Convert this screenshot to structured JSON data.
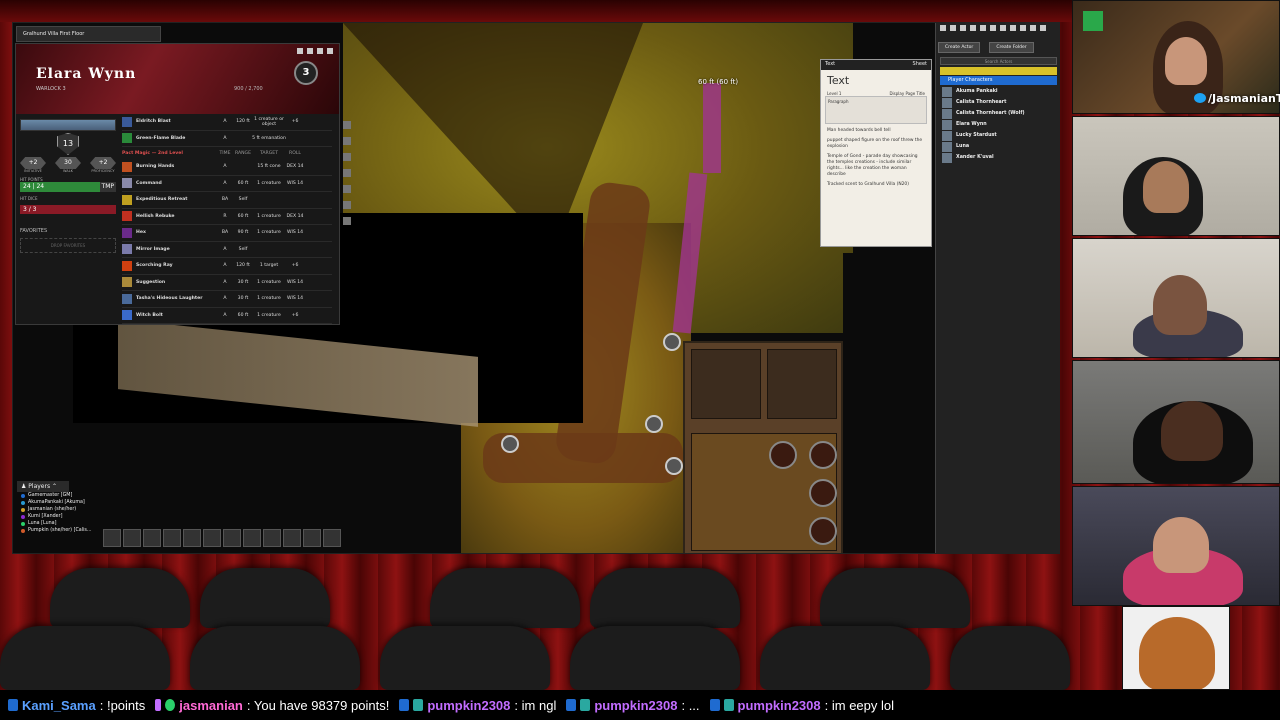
{
  "map": {
    "tab_title": "Gralhund Villa First Floor",
    "measure": "60 ft (60 ft)"
  },
  "sheet": {
    "name": "Elara Wynn",
    "class": "WARLOCK 3",
    "level": "3",
    "xp": "900 / 2,700",
    "ac": "13",
    "stats": [
      {
        "value": "+2",
        "label": "INITIATIVE"
      },
      {
        "value": "30",
        "label": "WALK"
      },
      {
        "value": "+2",
        "label": "PROFICIENCY"
      }
    ],
    "hp_label": "HIT POINTS",
    "hp": "24",
    "hp_max": "24",
    "tmp": "TMP",
    "hd_label": "HIT DICE",
    "hd": "3 / 3",
    "favorites": "FAVORITES",
    "drop_favorites": "DROP FAVORITES",
    "cantrips": [
      {
        "name": "Eldritch Blast",
        "time": "A",
        "range": "120 ft",
        "target": "1 creature or object",
        "roll": "+6",
        "color": "#3a5a9a"
      },
      {
        "name": "Green-Flame Blade",
        "time": "A",
        "range": "",
        "target": "5 ft emanation",
        "roll": "",
        "color": "#2a8a3a"
      }
    ],
    "section": {
      "title": "Pact Magic — 2nd Level",
      "cols": [
        "TIME",
        "RANGE",
        "TARGET",
        "ROLL"
      ]
    },
    "spells": [
      {
        "name": "Burning Hands",
        "time": "A",
        "range": "",
        "target": "15 ft cone",
        "roll": "DEX 14",
        "color": "#c05020"
      },
      {
        "name": "Command",
        "time": "A",
        "range": "60 ft",
        "target": "1 creature",
        "roll": "WIS 14",
        "color": "#8a8aaa"
      },
      {
        "name": "Expeditious Retreat",
        "time": "BA",
        "range": "Self",
        "target": "",
        "roll": "",
        "color": "#c0a020"
      },
      {
        "name": "Hellish Rebuke",
        "time": "R",
        "range": "60 ft",
        "target": "1 creature",
        "roll": "DEX 14",
        "color": "#c03020"
      },
      {
        "name": "Hex",
        "time": "BA",
        "range": "90 ft",
        "target": "1 creature",
        "roll": "WIS 14",
        "color": "#6a2a8a"
      },
      {
        "name": "Mirror Image",
        "time": "A",
        "range": "Self",
        "target": "",
        "roll": "",
        "color": "#7a7aaa"
      },
      {
        "name": "Scorching Ray",
        "time": "A",
        "range": "120 ft",
        "target": "1 target",
        "roll": "+6",
        "color": "#d04010"
      },
      {
        "name": "Suggestion",
        "time": "A",
        "range": "30 ft",
        "target": "1 creature",
        "roll": "WIS 14",
        "color": "#aa8a3a"
      },
      {
        "name": "Tasha's Hideous Laughter",
        "time": "A",
        "range": "30 ft",
        "target": "1 creature",
        "roll": "WIS 14",
        "color": "#4a6a9a"
      },
      {
        "name": "Witch Bolt",
        "time": "A",
        "range": "60 ft",
        "target": "1 creature",
        "roll": "+6",
        "color": "#3a6aca"
      }
    ]
  },
  "players": {
    "title": "Players",
    "list": [
      {
        "name": "Gamemaster [GM]",
        "color": "#1f6bd0"
      },
      {
        "name": "AkumaPankaki [Akuma]",
        "color": "#2a9ad0"
      },
      {
        "name": "Jasmanian (she/her)",
        "color": "#d0a02a"
      },
      {
        "name": "Kumi [Xander]",
        "color": "#8a2ad0"
      },
      {
        "name": "Luna [Luna]",
        "color": "#2ad06a"
      },
      {
        "name": "Pumpkin (she/her) [Calis...",
        "color": "#d05a2a"
      }
    ]
  },
  "handout": {
    "tab": "Text",
    "sheet_btn": "Sheet",
    "heading": "Text",
    "level": "Level 1",
    "display_page": "Display Page Title",
    "paragraph": "Paragraph",
    "notes": [
      "Man headed towards bell tell",
      "puppet shaped figure on the roof threw the explosion",
      "Temple of Gond - parade day showcasing the temples creations - include similar rights... like the creation the woman describe",
      "Tracked scent to Gralhund Villa (N20)"
    ]
  },
  "journal": {
    "create_actor": "Create Actor",
    "create_folder": "Create Folder",
    "search": "Search Actors",
    "folder": "Player Characters",
    "actors": [
      "Akuma Pankaki",
      "Calista Thornheart",
      "Calista Thornheart (Wolf)",
      "Elara Wynn",
      "Lucky Stardust",
      "Luna",
      "Xander K'uval"
    ]
  },
  "stream": {
    "handle": "/JasmanianTV"
  },
  "chat": [
    {
      "user": "Kami_Sama",
      "sep": ":",
      "msg": "!points",
      "color": "#5aa0ff"
    },
    {
      "user": "jasmanian",
      "sep": ":",
      "msg": "You have 98379 points!",
      "color": "#ff6ad5"
    },
    {
      "user": "pumpkin2308",
      "sep": ":",
      "msg": "im ngl",
      "color": "#c26dff"
    },
    {
      "user": "pumpkin2308",
      "sep": ":",
      "msg": "...",
      "color": "#c26dff"
    },
    {
      "user": "pumpkin2308",
      "sep": ":",
      "msg": "im eepy lol",
      "color": "#c26dff"
    }
  ]
}
